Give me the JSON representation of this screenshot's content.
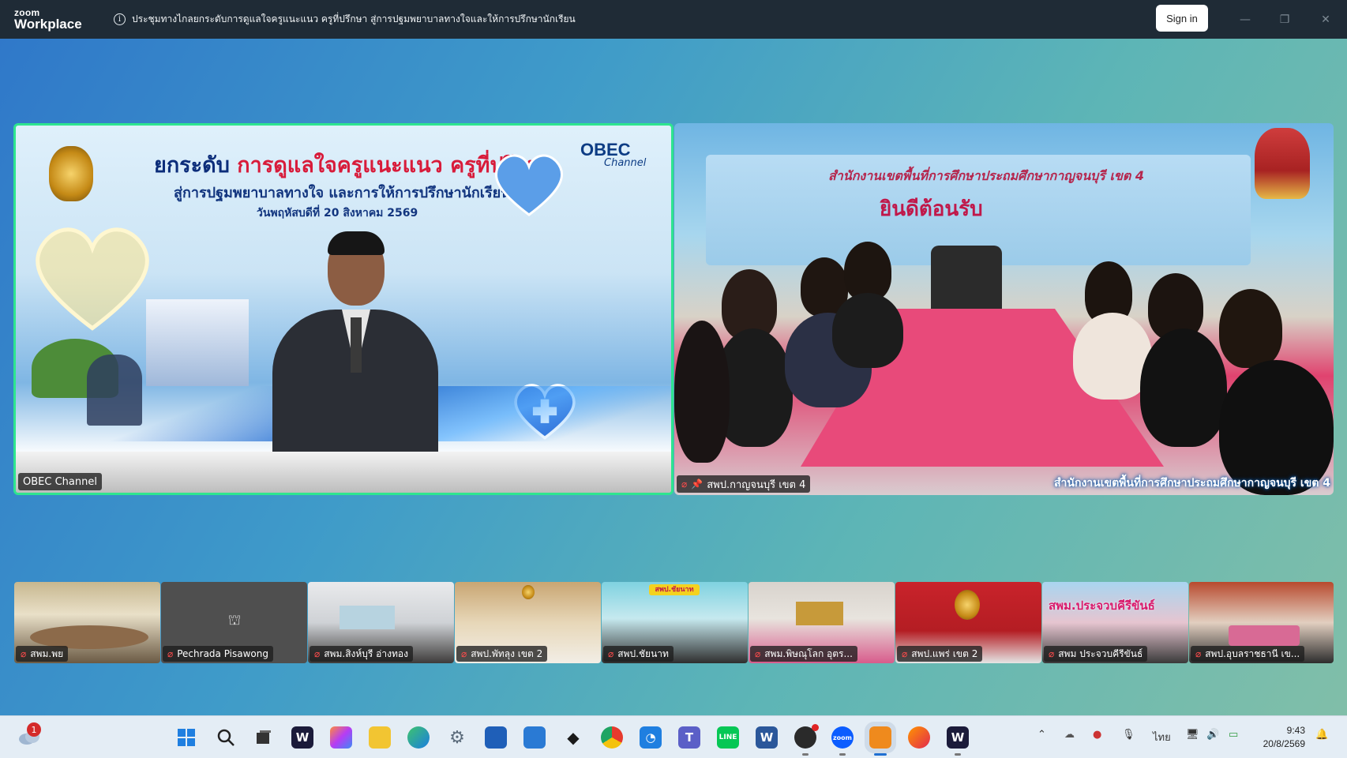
{
  "app": {
    "brand_top": "zoom",
    "brand_bottom": "Workplace",
    "meeting_title": "ประชุมทางไกลยกระดับการดูแลใจครูแนะแนว ครูที่ปรึกษา สู่การปฐมพยาบาลทางใจและให้การปรึกษานักเรียน",
    "sign_in_label": "Sign in",
    "minimize_glyph": "—",
    "restore_glyph": "❐",
    "close_glyph": "✕"
  },
  "colors": {
    "active_speaker_border": "#2ee58f",
    "titlebar_bg": "#1f2b36",
    "mic_off": "#ff4c4c"
  },
  "main_tiles": [
    {
      "name": "OBEC Channel",
      "muted": false,
      "pinned": false,
      "slide": {
        "title_part1": "ยกระดับ ",
        "title_part2": "การดูแลใจครูแนะแนว ครูที่ปรึกษา",
        "subtitle": "สู่การปฐมพยาบาลทางใจ และการให้การปรึกษานักเรียน",
        "date": "วันพฤหัสบดีที่ 20 สิงหาคม 2569",
        "logo_text": "OBEC",
        "logo_sub": "Channel"
      }
    },
    {
      "name": "สพป.กาญจนบุรี เขต 4",
      "muted": true,
      "pinned": true,
      "banner_line1": "สำนักงานเขตพื้นที่การศึกษาประถมศึกษากาญจนบุรี เขต 4",
      "banner_line2": "ยินดีต้อนรับ",
      "caption": "สำนักงานเขตพื้นที่การศึกษาประถมศึกษากาญจนบุรี เขต 4"
    }
  ],
  "strip": [
    {
      "name": "สพม.พย",
      "muted": true
    },
    {
      "name": "Pechrada Pisawong",
      "muted": true,
      "video_off": true
    },
    {
      "name": "สพม.สิงห์บุรี อ่างทอง",
      "muted": true
    },
    {
      "name": "สพป.พัทลุง เขต 2",
      "muted": true
    },
    {
      "name": "สพป.ชัยนาท",
      "muted": true
    },
    {
      "name": "สพม.พิษณุโลก อุตร...",
      "muted": true
    },
    {
      "name": "สพป.แพร่ เขต 2",
      "muted": true
    },
    {
      "name": "สพม ประจวบคีรีขันธ์",
      "muted": true
    },
    {
      "name": "สพป.อุบลราชธานี เข...",
      "muted": true
    }
  ],
  "strip_banners": {
    "prachuap": "สพม.ประจวบคีรีขันธ์",
    "chainat": "สพป.ชัยนาท"
  },
  "taskbar": {
    "notification_count": "1",
    "icons": [
      "windows-start-icon",
      "search-icon",
      "task-view-icon",
      "webex-icon",
      "copilot-icon",
      "file-explorer-icon",
      "edge-icon",
      "settings-icon",
      "microsoft-store-icon",
      "outlook-icon",
      "dropbox-icon",
      "chrome-icon",
      "clock-app-icon",
      "teams-icon",
      "line-icon",
      "word-icon",
      "obs-icon",
      "zoom-icon",
      "active-app-icon",
      "firefox-icon",
      "webex-meetings-icon"
    ],
    "language": "ไทย",
    "time": "9:43",
    "date": "20/8/2569"
  }
}
